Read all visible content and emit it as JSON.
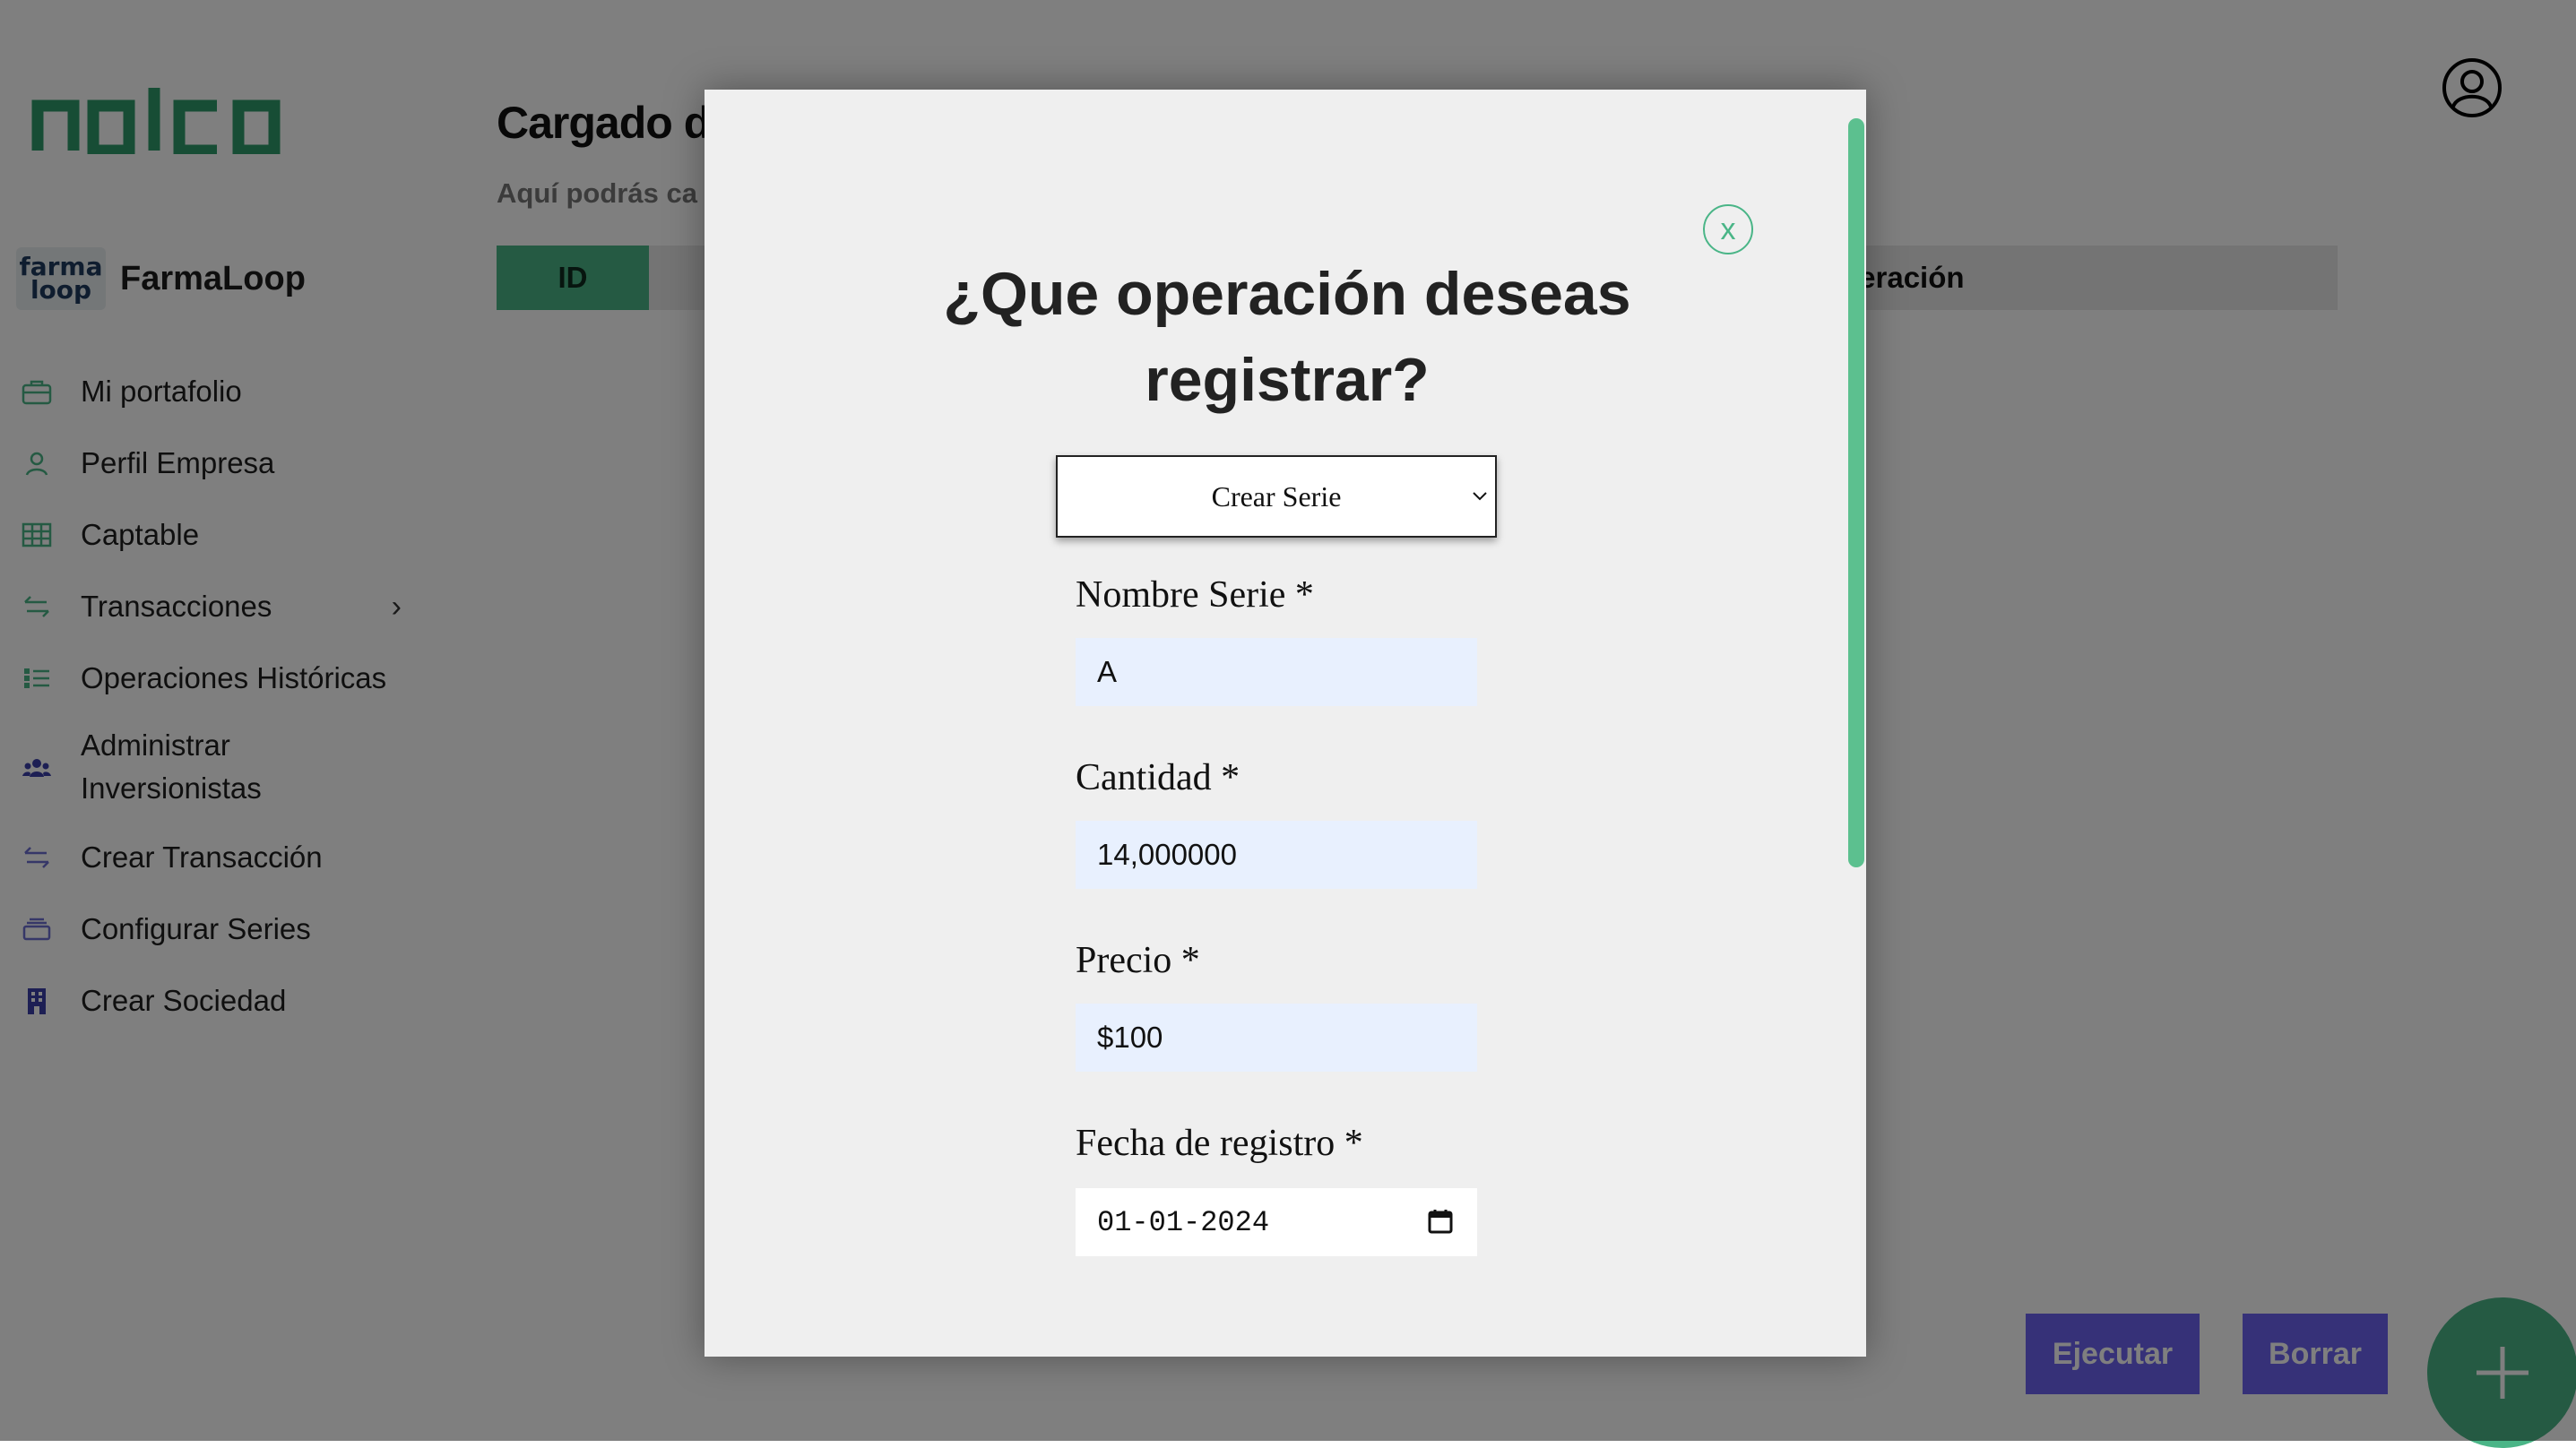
{
  "sidebar": {
    "logo_text": "nalca",
    "company": {
      "logo_line1": "farma",
      "logo_line2": "loop",
      "name": "FarmaLoop"
    },
    "items": [
      {
        "label": "Mi portafolio",
        "icon": "briefcase-icon"
      },
      {
        "label": "Perfil Empresa",
        "icon": "user-icon"
      },
      {
        "label": "Captable",
        "icon": "table-icon"
      },
      {
        "label": "Transacciones",
        "icon": "transfer-icon",
        "has_chevron": true
      },
      {
        "label": "Operaciones Históricas",
        "icon": "list-icon"
      },
      {
        "label": "Administrar",
        "label2": "Inversionistas",
        "icon": "group-icon"
      },
      {
        "label": "Crear Transacción",
        "icon": "transfer-icon"
      },
      {
        "label": "Configurar Series",
        "icon": "layers-icon"
      },
      {
        "label": "Crear Sociedad",
        "icon": "building-icon"
      }
    ],
    "chevron": "›"
  },
  "main": {
    "title": "Cargado d",
    "subtitle": "Aquí podrás ca",
    "table": {
      "col_id": "ID",
      "col_operation": "peración"
    },
    "buttons": {
      "execute": "Ejecutar",
      "delete": "Borrar"
    }
  },
  "modal": {
    "close_label": "x",
    "title_line1": "¿Que operación deseas",
    "title_line2": "registrar?",
    "operation_select": "Crear Serie",
    "fields": {
      "series_name": {
        "label": "Nombre Serie *",
        "value": "A"
      },
      "quantity": {
        "label": "Cantidad *",
        "value": "14,000000"
      },
      "price": {
        "label": "Precio *",
        "value": "$100"
      },
      "date": {
        "label": "Fecha de registro *",
        "value": "01-01-2024"
      }
    }
  },
  "colors": {
    "accent_green": "#4ab587",
    "button_purple": "#6c62f0",
    "logo_green": "#2f9a6a",
    "sidebar_icon": "#4ab587",
    "sidebar_icon_alt": "#3b3fa8"
  }
}
